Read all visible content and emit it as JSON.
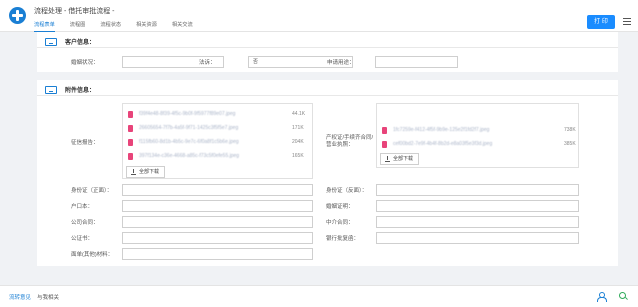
{
  "header": {
    "title": "流程处理 - 借托审批流程 -",
    "tabs": [
      "流程表单",
      "流程图",
      "流程状态",
      "相关资源",
      "相关交流"
    ],
    "print_label": "打 印"
  },
  "customer": {
    "title": "客户信息：",
    "fields": [
      {
        "label": "婚姻状况：",
        "value": ""
      },
      {
        "label": "法诉：",
        "value": "否"
      },
      {
        "label": "申请用途：",
        "value": ""
      }
    ]
  },
  "attachments": {
    "title": "附件信息：",
    "credit_report": {
      "label": "征信报告：",
      "files": [
        {
          "name": "f39f4e48-8f39-4f5c-9b0f-9f5977f89e07.jpeg",
          "size": "44.1K"
        },
        {
          "name": "26605654-7f7b-4a5f-9f71-1425c3f5f5e7.jpeg",
          "size": "171K"
        },
        {
          "name": "f115fb60-8d1b-4b5c-9e7c-6f0a8f1c5b6e.jpeg",
          "size": "204K"
        },
        {
          "name": "397f134e-c36e-4668-a85c-f73c5f0efe55.jpeg",
          "size": "165K"
        }
      ],
      "download_label": "全部下载"
    },
    "property": {
      "label": "产权证/手续齐合同/营业执照：",
      "files": [
        {
          "name": "1fc7259e-f412-4f5f-9b9e-125e2f1fd2f7.jpeg",
          "size": "738K"
        },
        {
          "name": "cef00bd2-7e9f-4b4f-8b2d-e8a03f5e3f3d.jpeg",
          "size": "385K"
        }
      ],
      "download_label": "全部下载"
    },
    "rows": [
      {
        "left": "身份证（正面）：",
        "right": "身份证（反面）："
      },
      {
        "left": "户口本：",
        "right": "婚姻证明："
      },
      {
        "left": "公司合同：",
        "right": "中介合同："
      },
      {
        "left": "公证书：",
        "right": "银行批复函："
      },
      {
        "left": "面单(其他)材料：",
        "right": ""
      }
    ]
  },
  "footer": {
    "tabs": [
      "流转意见",
      "与我相关"
    ]
  }
}
